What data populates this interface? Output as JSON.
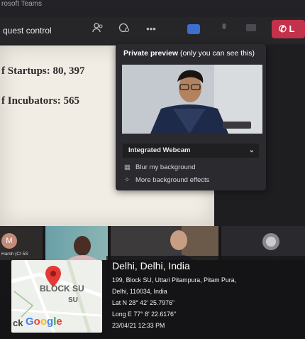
{
  "app": {
    "title": "rosoft Teams"
  },
  "toolbar": {
    "request_control": "quest control",
    "leave_label": "L",
    "more": "•••"
  },
  "slide": {
    "line1": "f Startups: 80, 397",
    "line2": "f Incubators: 565"
  },
  "preview": {
    "title_bold": "Private preview",
    "title_rest": " (only you can see this)",
    "camera_select": "Integrated Webcam",
    "blur_option": "Blur my background",
    "effects_option": "More background effects"
  },
  "gallery": {
    "initials": "M",
    "participant_label": "Harsh (CI 5S"
  },
  "geotag": {
    "city": "Delhi, Delhi, India",
    "address1": "199, Block SU, Uttari Pitampura, Pitam Pura,",
    "address2": "Delhi, 110034, India",
    "lat": "Lat N 28° 42' 25.7976\"",
    "long": "Long E 77° 8' 22.6176\"",
    "datetime": "23/04/21 12:33 PM",
    "map_label1": "BLOCK SU",
    "map_label2": "SU",
    "map_partial": "ck",
    "map_logo": "Google"
  },
  "colors": {
    "accent": "#3d6fd1",
    "leave": "#c4314b",
    "pin": "#e53935"
  }
}
